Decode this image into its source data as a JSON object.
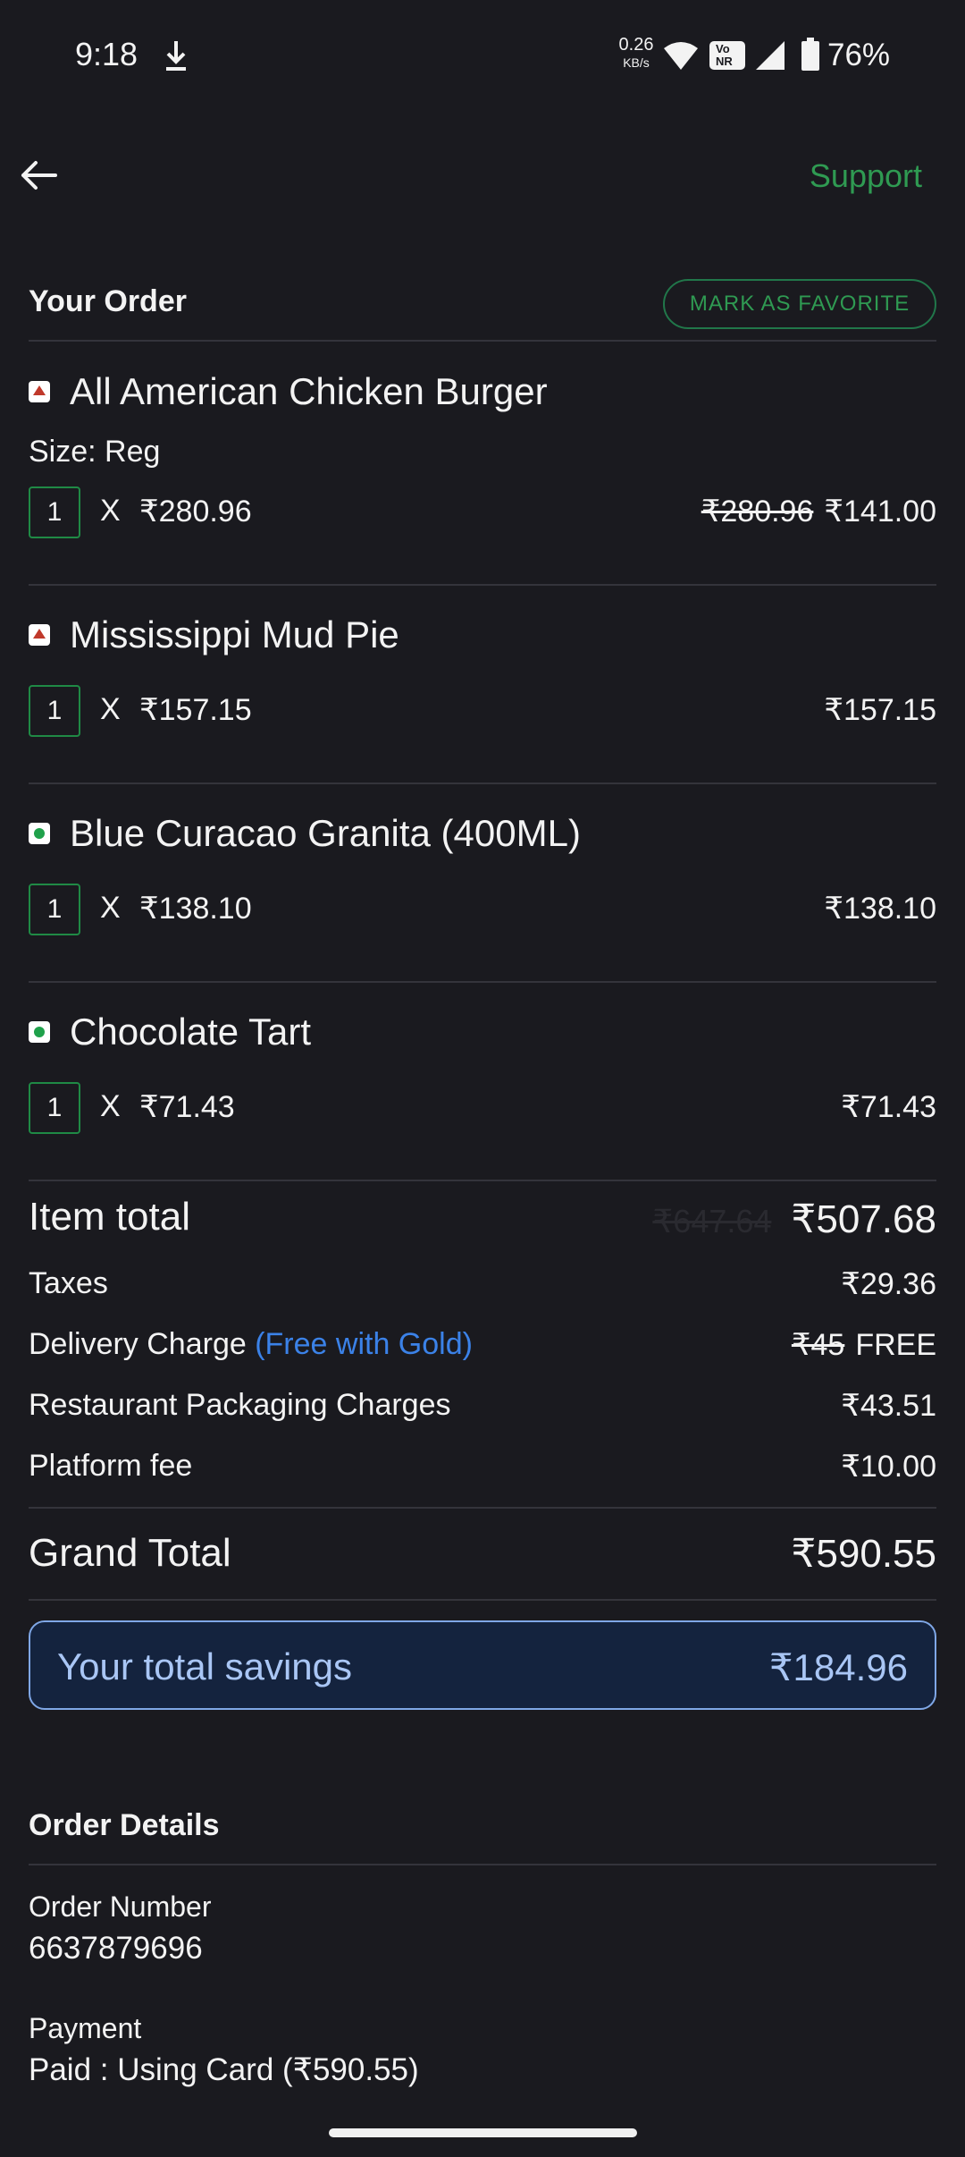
{
  "status_bar": {
    "time": "9:18",
    "net_speed_value": "0.26",
    "net_speed_unit": "KB/s",
    "volte_top": "Vo",
    "volte_bottom": "NR",
    "battery_percent": "76%"
  },
  "header": {
    "support_label": "Support"
  },
  "order": {
    "title": "Your Order",
    "favorite_label": "MARK AS FAVORITE",
    "items": [
      {
        "name": "All American Chicken Burger",
        "type": "non-veg",
        "size": "Size: Reg",
        "qty": "1",
        "x": "X",
        "unit_price": "₹280.96",
        "original_price": "₹280.96",
        "price": "₹141.00"
      },
      {
        "name": "Mississippi Mud Pie",
        "type": "non-veg",
        "qty": "1",
        "x": "X",
        "unit_price": "₹157.15",
        "price": "₹157.15"
      },
      {
        "name": "Blue Curacao Granita (400ML)",
        "type": "veg",
        "qty": "1",
        "x": "X",
        "unit_price": "₹138.10",
        "price": "₹138.10"
      },
      {
        "name": "Chocolate Tart",
        "type": "veg",
        "qty": "1",
        "x": "X",
        "unit_price": "₹71.43",
        "price": "₹71.43"
      }
    ]
  },
  "bill": {
    "item_total_label": "Item total",
    "item_total_original": "₹647.64",
    "item_total_value": "₹507.68",
    "taxes_label": "Taxes",
    "taxes_value": "₹29.36",
    "delivery_label": "Delivery Charge",
    "delivery_note": "(Free with Gold)",
    "delivery_original": "₹45",
    "delivery_value": "FREE",
    "packaging_label": "Restaurant Packaging Charges",
    "packaging_value": "₹43.51",
    "platform_label": "Platform fee",
    "platform_value": "₹10.00",
    "grand_total_label": "Grand Total",
    "grand_total_value": "₹590.55",
    "savings_label": "Your total savings",
    "savings_value": "₹184.96"
  },
  "details": {
    "title": "Order Details",
    "order_number_label": "Order Number",
    "order_number_value": "6637879696",
    "payment_label": "Payment",
    "payment_value": "Paid : Using Card (₹590.55)"
  },
  "colors": {
    "background": "#1a1a1f",
    "accent_green": "#2f9a52",
    "link_blue": "#3b82e8",
    "savings_bg": "#14233e"
  }
}
